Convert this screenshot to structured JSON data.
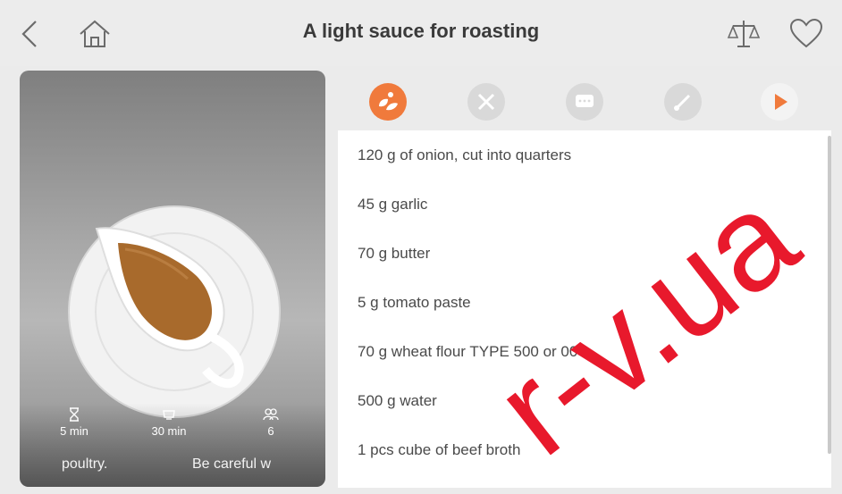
{
  "header": {
    "title": "A light sauce for roasting"
  },
  "icons": {
    "back": "chevron-left-icon",
    "home": "home-icon",
    "scale": "scale-icon",
    "favorite": "heart-icon"
  },
  "recipe": {
    "prep_time": "5 min",
    "cook_time": "30 min",
    "servings": "6",
    "tags": [
      "poultry.",
      "Be careful w"
    ]
  },
  "tabs": [
    {
      "name": "ingredients",
      "active": true
    },
    {
      "name": "utensils",
      "active": false
    },
    {
      "name": "comments",
      "active": false
    },
    {
      "name": "tips",
      "active": false
    },
    {
      "name": "start-cooking",
      "active": false
    }
  ],
  "ingredients": [
    "120 g of onion, cut into quarters",
    "45 g garlic",
    "70 g butter",
    "5 g tomato paste",
    "70 g wheat flour TYPE 500 or 00",
    "500 g water",
    "1 pcs cube of beef broth"
  ],
  "watermark": "r-v.ua",
  "colors": {
    "accent": "#f07a3c",
    "inactive": "#d9d9d9",
    "text": "#4a4a4a",
    "watermark": "#e8192c"
  }
}
